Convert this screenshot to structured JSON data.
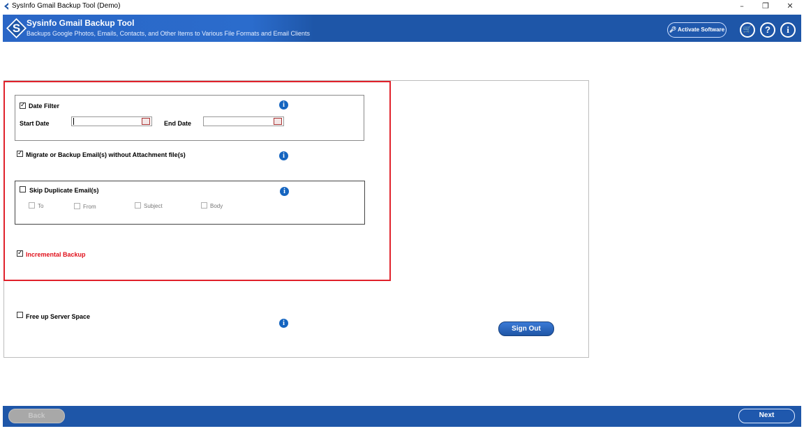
{
  "window": {
    "title": "SysInfo Gmail Backup Tool (Demo)",
    "minimize": "–",
    "restore": "❐",
    "close": "✕"
  },
  "banner": {
    "title": "Sysinfo Gmail Backup Tool",
    "subtitle": "Backups Google Photos, Emails, Contacts, and Other Items to Various File Formats and Email Clients",
    "activate_label": "Activate Software",
    "cart_glyph": "🛒",
    "help_glyph": "?",
    "info_glyph": "i"
  },
  "filters": {
    "date_filter": {
      "label": "Date Filter",
      "checked": true,
      "start_label": "Start Date",
      "end_label": "End Date",
      "start_value": "",
      "end_value": ""
    },
    "no_attachment": {
      "label": "Migrate or Backup Email(s) without Attachment file(s)",
      "checked": true
    },
    "skip_duplicate": {
      "label": "Skip Duplicate Email(s)",
      "checked": false,
      "options": [
        "To",
        "From",
        "Subject",
        "Body"
      ]
    },
    "incremental": {
      "label": "Incremental Backup",
      "checked": true
    },
    "free_space": {
      "label": "Free up Server Space",
      "checked": false
    }
  },
  "actions": {
    "sign_out": "Sign Out",
    "back": "Back",
    "next": "Next"
  },
  "colors": {
    "brand": "#1e56a8",
    "highlight": "#e0212b",
    "info": "#1565c0"
  }
}
